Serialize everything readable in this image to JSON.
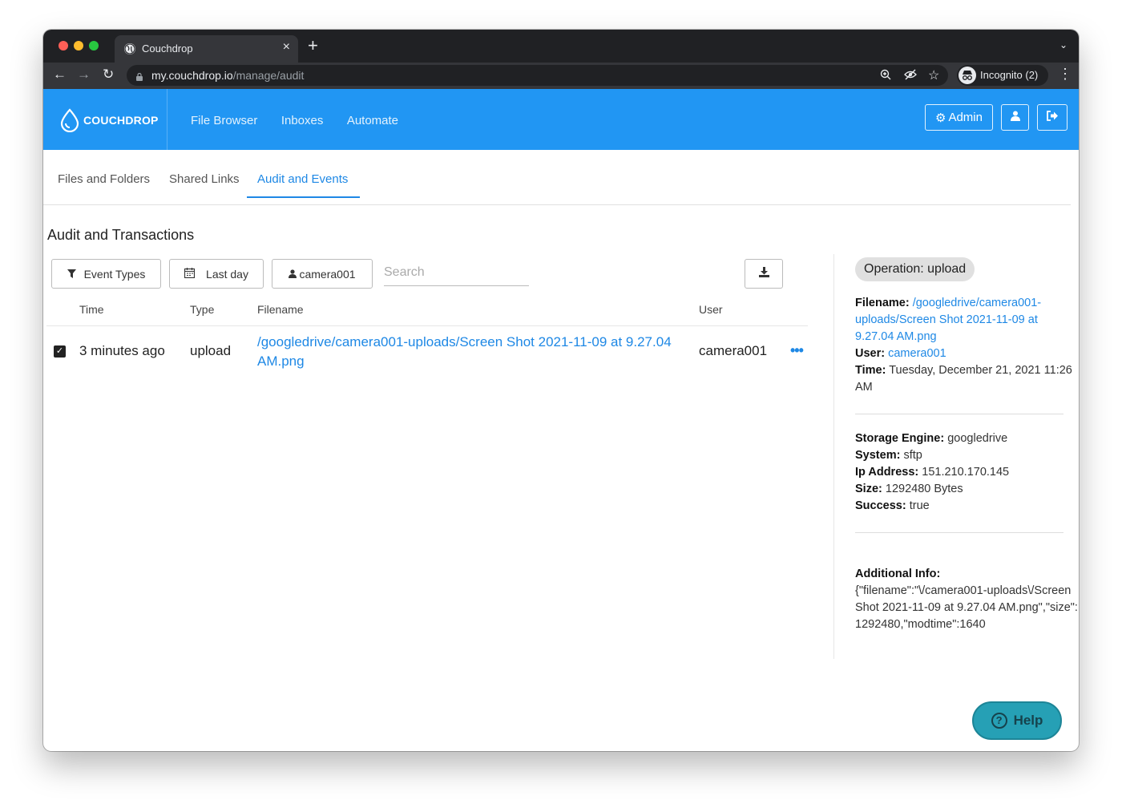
{
  "browser": {
    "tab_title": "Couchdrop",
    "url_host": "my.couchdrop.io",
    "url_path": "/manage/audit",
    "incognito_label": "Incognito (2)"
  },
  "header": {
    "brand": "COUCHDROP",
    "nav": [
      "File Browser",
      "Inboxes",
      "Automate"
    ],
    "admin_label": "Admin"
  },
  "subtabs": [
    "Files and Folders",
    "Shared Links",
    "Audit and Events"
  ],
  "page": {
    "title": "Audit and Transactions",
    "filters": {
      "event_types": "Event Types",
      "date_range": "Last day",
      "user": "camera001"
    },
    "search_placeholder": "Search"
  },
  "table": {
    "columns": [
      "Time",
      "Type",
      "Filename",
      "User"
    ],
    "rows": [
      {
        "selected": true,
        "time": "3 minutes ago",
        "type": "upload",
        "filename": "/googledrive/camera001-uploads/Screen Shot 2021-11-09 at 9.27.04 AM.png",
        "user": "camera001"
      }
    ]
  },
  "details": {
    "operation": "Operation: upload",
    "filename_label": "Filename:",
    "filename": "/googledrive/camera001-uploads/Screen Shot 2021-11-09 at 9.27.04 AM.png",
    "user_label": "User:",
    "user": "camera001",
    "time_label": "Time:",
    "time": "Tuesday, December 21, 2021 11:26 AM",
    "storage_label": "Storage Engine:",
    "storage": "googledrive",
    "system_label": "System:",
    "system": "sftp",
    "ip_label": "Ip Address:",
    "ip": "151.210.170.145",
    "size_label": "Size:",
    "size": "1292480 Bytes",
    "success_label": "Success:",
    "success": "true",
    "additional_label": "Additional Info:",
    "additional": "{\"filename\":\"\\/camera001-uploads\\/Screen Shot 2021-11-09 at 9.27.04 AM.png\",\"size\":1292480,\"modtime\":1640"
  },
  "help_label": "Help",
  "colors": {
    "brand": "#2196f3",
    "link": "#1e88e5",
    "help": "#26a0b5"
  }
}
